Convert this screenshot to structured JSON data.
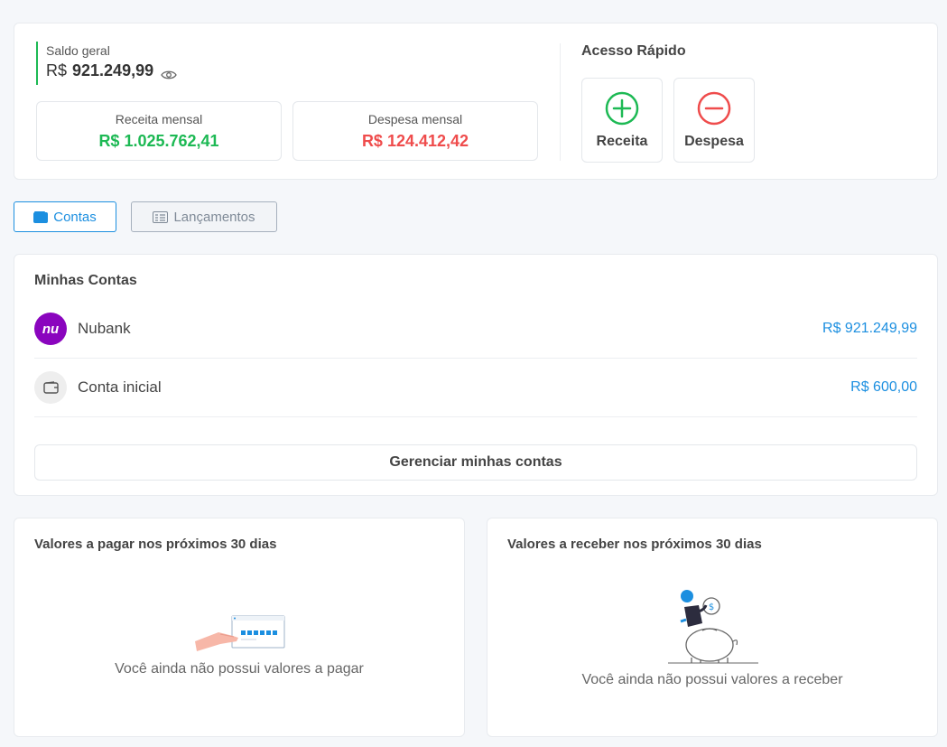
{
  "summary": {
    "saldo_label": "Saldo geral",
    "saldo_currency": "R$",
    "saldo_value": "921.249,99",
    "receita_label": "Receita mensal",
    "receita_value": "R$ 1.025.762,41",
    "despesa_label": "Despesa mensal",
    "despesa_value": "R$ 124.412,42",
    "quick_access_title": "Acesso Rápido",
    "quick_receita": "Receita",
    "quick_despesa": "Despesa"
  },
  "tabs": [
    {
      "label": "Contas",
      "active": true
    },
    {
      "label": "Lançamentos",
      "active": false
    }
  ],
  "accounts": {
    "title": "Minhas Contas",
    "items": [
      {
        "name": "Nubank",
        "value": "R$ 921.249,99",
        "icon": "nubank-logo",
        "icon_text": "nu"
      },
      {
        "name": "Conta inicial",
        "value": "R$ 600,00",
        "icon": "wallet-icon"
      }
    ],
    "manage_label": "Gerenciar minhas contas"
  },
  "payables": {
    "title": "Valores a pagar nos próximos 30 dias",
    "empty_text": "Você ainda não possui valores a pagar"
  },
  "receivables": {
    "title": "Valores a receber nos próximos 30 dias",
    "empty_text": "Você ainda não possui valores a receber"
  },
  "colors": {
    "income": "#1db954",
    "expense": "#ef4c4c",
    "accent": "#1c8fe0",
    "nubank": "#8a05be"
  }
}
